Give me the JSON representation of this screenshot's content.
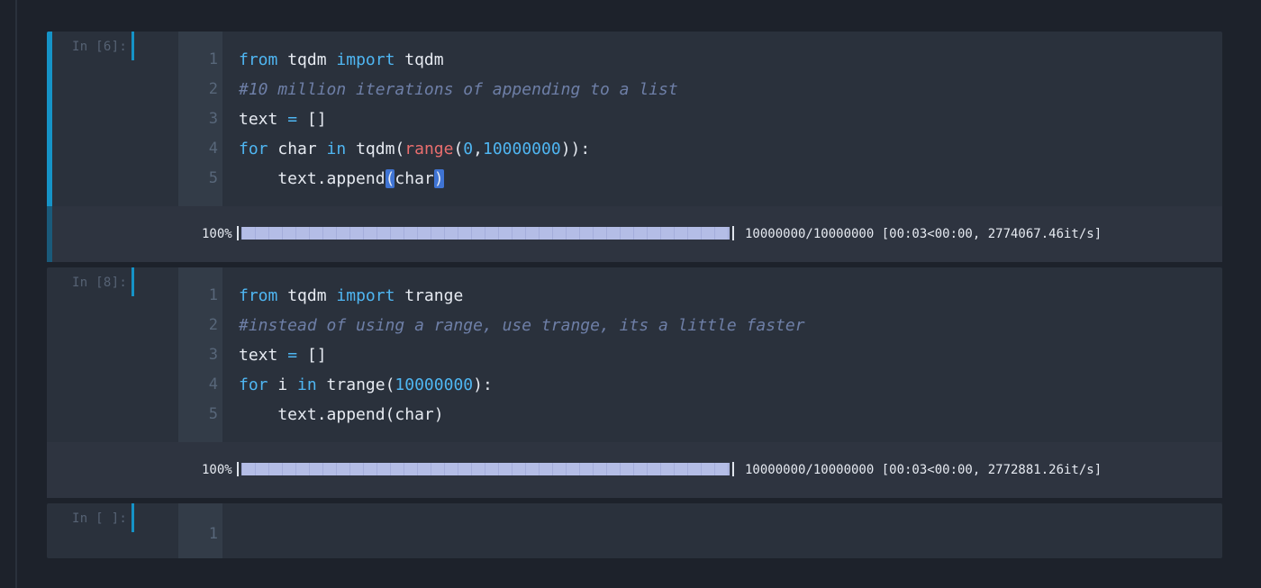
{
  "cells": [
    {
      "prompt": "In [6]:",
      "selected": true,
      "line_numbers": [
        "1",
        "2",
        "3",
        "4",
        "5"
      ],
      "code": [
        [
          {
            "t": "from",
            "c": "kw"
          },
          {
            "t": " tqdm "
          },
          {
            "t": "import",
            "c": "kw"
          },
          {
            "t": " tqdm"
          }
        ],
        [
          {
            "t": "#10 million iterations of appending to a list",
            "c": "cm"
          }
        ],
        [
          {
            "t": "text "
          },
          {
            "t": "=",
            "c": "kw"
          },
          {
            "t": " []"
          }
        ],
        [
          {
            "t": "for",
            "c": "kw"
          },
          {
            "t": " char "
          },
          {
            "t": "in",
            "c": "kw"
          },
          {
            "t": " tqdm("
          },
          {
            "t": "range",
            "c": "bi"
          },
          {
            "t": "("
          },
          {
            "t": "0",
            "c": "num"
          },
          {
            "t": ","
          },
          {
            "t": "10000000",
            "c": "num"
          },
          {
            "t": ")):"
          }
        ],
        [
          {
            "t": "    text.append"
          },
          {
            "t": "(",
            "c": "hl"
          },
          {
            "t": "char"
          },
          {
            "t": ")",
            "c": "hl"
          }
        ]
      ],
      "output": {
        "percent": "100%",
        "progress": 1.0,
        "stats": "10000000/10000000 [00:03<00:00, 2774067.46it/s]"
      }
    },
    {
      "prompt": "In [8]:",
      "selected": false,
      "line_numbers": [
        "1",
        "2",
        "3",
        "4",
        "5"
      ],
      "code": [
        [
          {
            "t": "from",
            "c": "kw"
          },
          {
            "t": " tqdm "
          },
          {
            "t": "import",
            "c": "kw"
          },
          {
            "t": " trange"
          }
        ],
        [
          {
            "t": "#instead of using a range, use trange, its a little faster",
            "c": "cm"
          }
        ],
        [
          {
            "t": "text "
          },
          {
            "t": "=",
            "c": "kw"
          },
          {
            "t": " []"
          }
        ],
        [
          {
            "t": "for",
            "c": "kw"
          },
          {
            "t": " i "
          },
          {
            "t": "in",
            "c": "kw"
          },
          {
            "t": " trange("
          },
          {
            "t": "10000000",
            "c": "num"
          },
          {
            "t": "):"
          }
        ],
        [
          {
            "t": "    text.append(char)"
          }
        ]
      ],
      "output": {
        "percent": "100%",
        "progress": 1.0,
        "stats": "10000000/10000000 [00:03<00:00, 2772881.26it/s]"
      }
    },
    {
      "prompt": "In [ ]:",
      "selected": false,
      "line_numbers": [
        "1"
      ],
      "code": [
        []
      ]
    }
  ],
  "colors": {
    "accent": "#1593c7",
    "keyword": "#4fb6f2",
    "builtin": "#e96e6e",
    "comment": "#6e7fa7",
    "progress_fill": "#b4bde6"
  }
}
